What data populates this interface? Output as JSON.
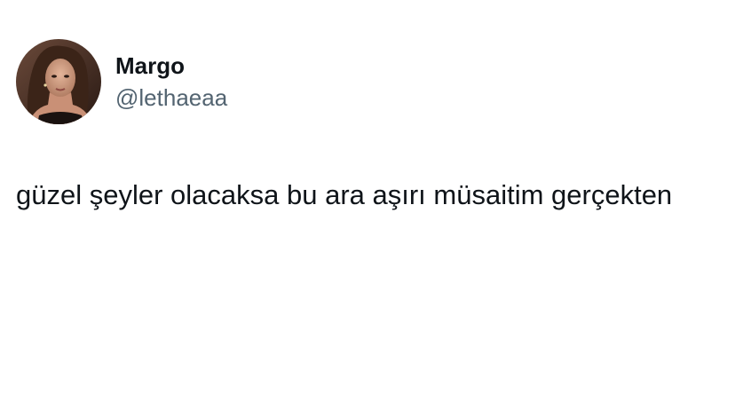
{
  "tweet": {
    "author": {
      "display_name": "Margo",
      "handle": "@lethaeaa",
      "avatar_icon": "profile-photo"
    },
    "text": "güzel şeyler olacaksa bu ara aşırı müsaitim gerçekten"
  },
  "colors": {
    "background": "#ffffff",
    "text_primary": "#0f1419",
    "text_secondary": "#536471"
  }
}
